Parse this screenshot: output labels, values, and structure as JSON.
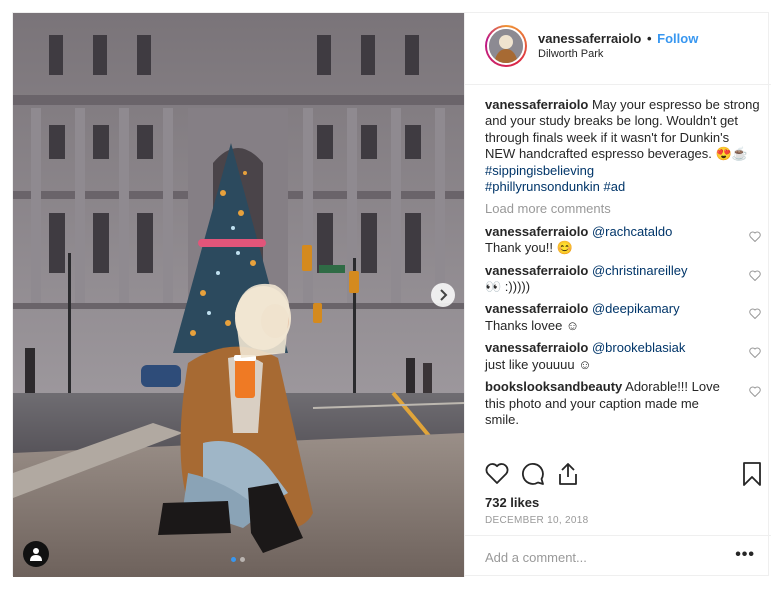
{
  "header": {
    "username": "vanessaferraiolo",
    "separator": "•",
    "follow_label": "Follow",
    "location": "Dilworth Park"
  },
  "caption": {
    "username": "vanessaferraiolo",
    "text": "May your espresso be strong and your study breaks be long. Wouldn't get through finals week if it wasn't for Dunkin's NEW handcrafted espresso beverages. 😍☕",
    "hashtag1": "#sippingisbelieving",
    "hashtag2": "#phillyrunsondunkin",
    "hashtag3": "#ad"
  },
  "load_more_label": "Load more comments",
  "comments": [
    {
      "username": "vanessaferraiolo",
      "mention": "@rachcataldo",
      "text": "Thank you!! 😊"
    },
    {
      "username": "vanessaferraiolo",
      "mention": "@christinareilley",
      "text": "👀 :)))))"
    },
    {
      "username": "vanessaferraiolo",
      "mention": "@deepikamary",
      "text": "Thanks lovee ☺"
    },
    {
      "username": "vanessaferraiolo",
      "mention": "@brookeblasiak",
      "text": "just like youuuu ☺"
    },
    {
      "username": "bookslooksandbeauty",
      "mention": "",
      "text": "Adorable!!! Love this photo and your caption made me smile."
    }
  ],
  "likes": "732 likes",
  "date": "DECEMBER 10, 2018",
  "add_comment_placeholder": "Add a comment...",
  "more_options": "•••",
  "icons": {
    "like": "heart-icon",
    "comment": "comment-icon",
    "share": "share-icon",
    "save": "bookmark-icon",
    "next": "chevron-right-icon",
    "tags": "user-tag-icon"
  },
  "colors": {
    "link_blue": "#3897f0",
    "hashtag": "#003569",
    "muted": "#999999"
  }
}
